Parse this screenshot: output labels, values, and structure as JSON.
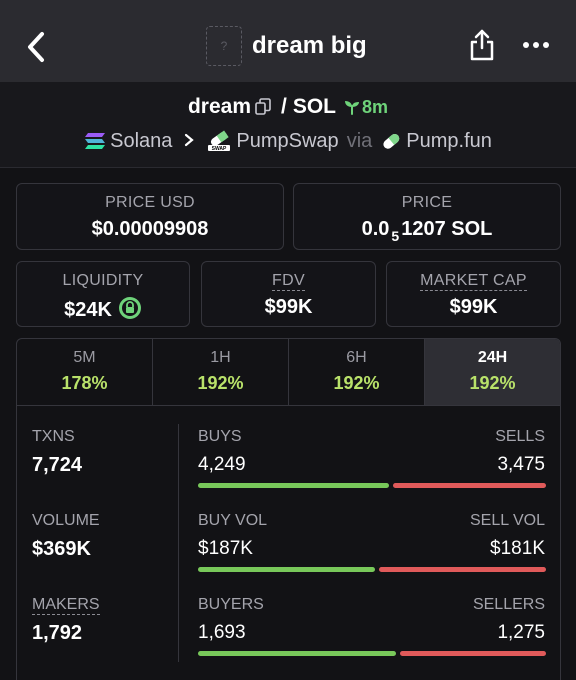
{
  "header": {
    "title": "dream big",
    "token_image_placeholder": "?",
    "back_icon": "chevron-left-icon",
    "share_icon": "share-icon",
    "more_icon": "more-dots-icon"
  },
  "pair": {
    "base": "dream",
    "slash": "/",
    "quote": "SOL",
    "age": "8m",
    "chain": "Solana",
    "dex": "PumpSwap",
    "via": "via",
    "launchpad": "Pump.fun"
  },
  "price": {
    "usd_label": "PRICE USD",
    "usd_value": "$0.00009908",
    "native_label": "PRICE",
    "native_prefix": "0.0",
    "native_subscript": "5",
    "native_rest": "1207 SOL"
  },
  "metrics": {
    "liquidity_label": "LIQUIDITY",
    "liquidity_value": "$24K",
    "fdv_label": "FDV",
    "fdv_value": "$99K",
    "mcap_label": "MARKET CAP",
    "mcap_value": "$99K"
  },
  "tabs": [
    {
      "label": "5M",
      "value": "178%"
    },
    {
      "label": "1H",
      "value": "192%"
    },
    {
      "label": "6H",
      "value": "192%"
    },
    {
      "label": "24H",
      "value": "192%"
    }
  ],
  "stats": {
    "txns_label": "TXNS",
    "txns_value": "7,724",
    "buys_label": "BUYS",
    "buys_value": "4,249",
    "sells_label": "SELLS",
    "sells_value": "3,475",
    "buys_fraction": 0.55,
    "volume_label": "VOLUME",
    "volume_value": "$369K",
    "buy_vol_label": "BUY VOL",
    "buy_vol_value": "$187K",
    "sell_vol_label": "SELL VOL",
    "sell_vol_value": "$181K",
    "buy_vol_fraction": 0.51,
    "makers_label": "MAKERS",
    "makers_value": "1,792",
    "buyers_label": "BUYERS",
    "buyers_value": "1,693",
    "sellers_label": "SELLERS",
    "sellers_value": "1,275",
    "buyers_fraction": 0.57
  },
  "colors": {
    "positive": "#b9e26a",
    "buy": "#78c85a",
    "sell": "#e05a5a"
  }
}
